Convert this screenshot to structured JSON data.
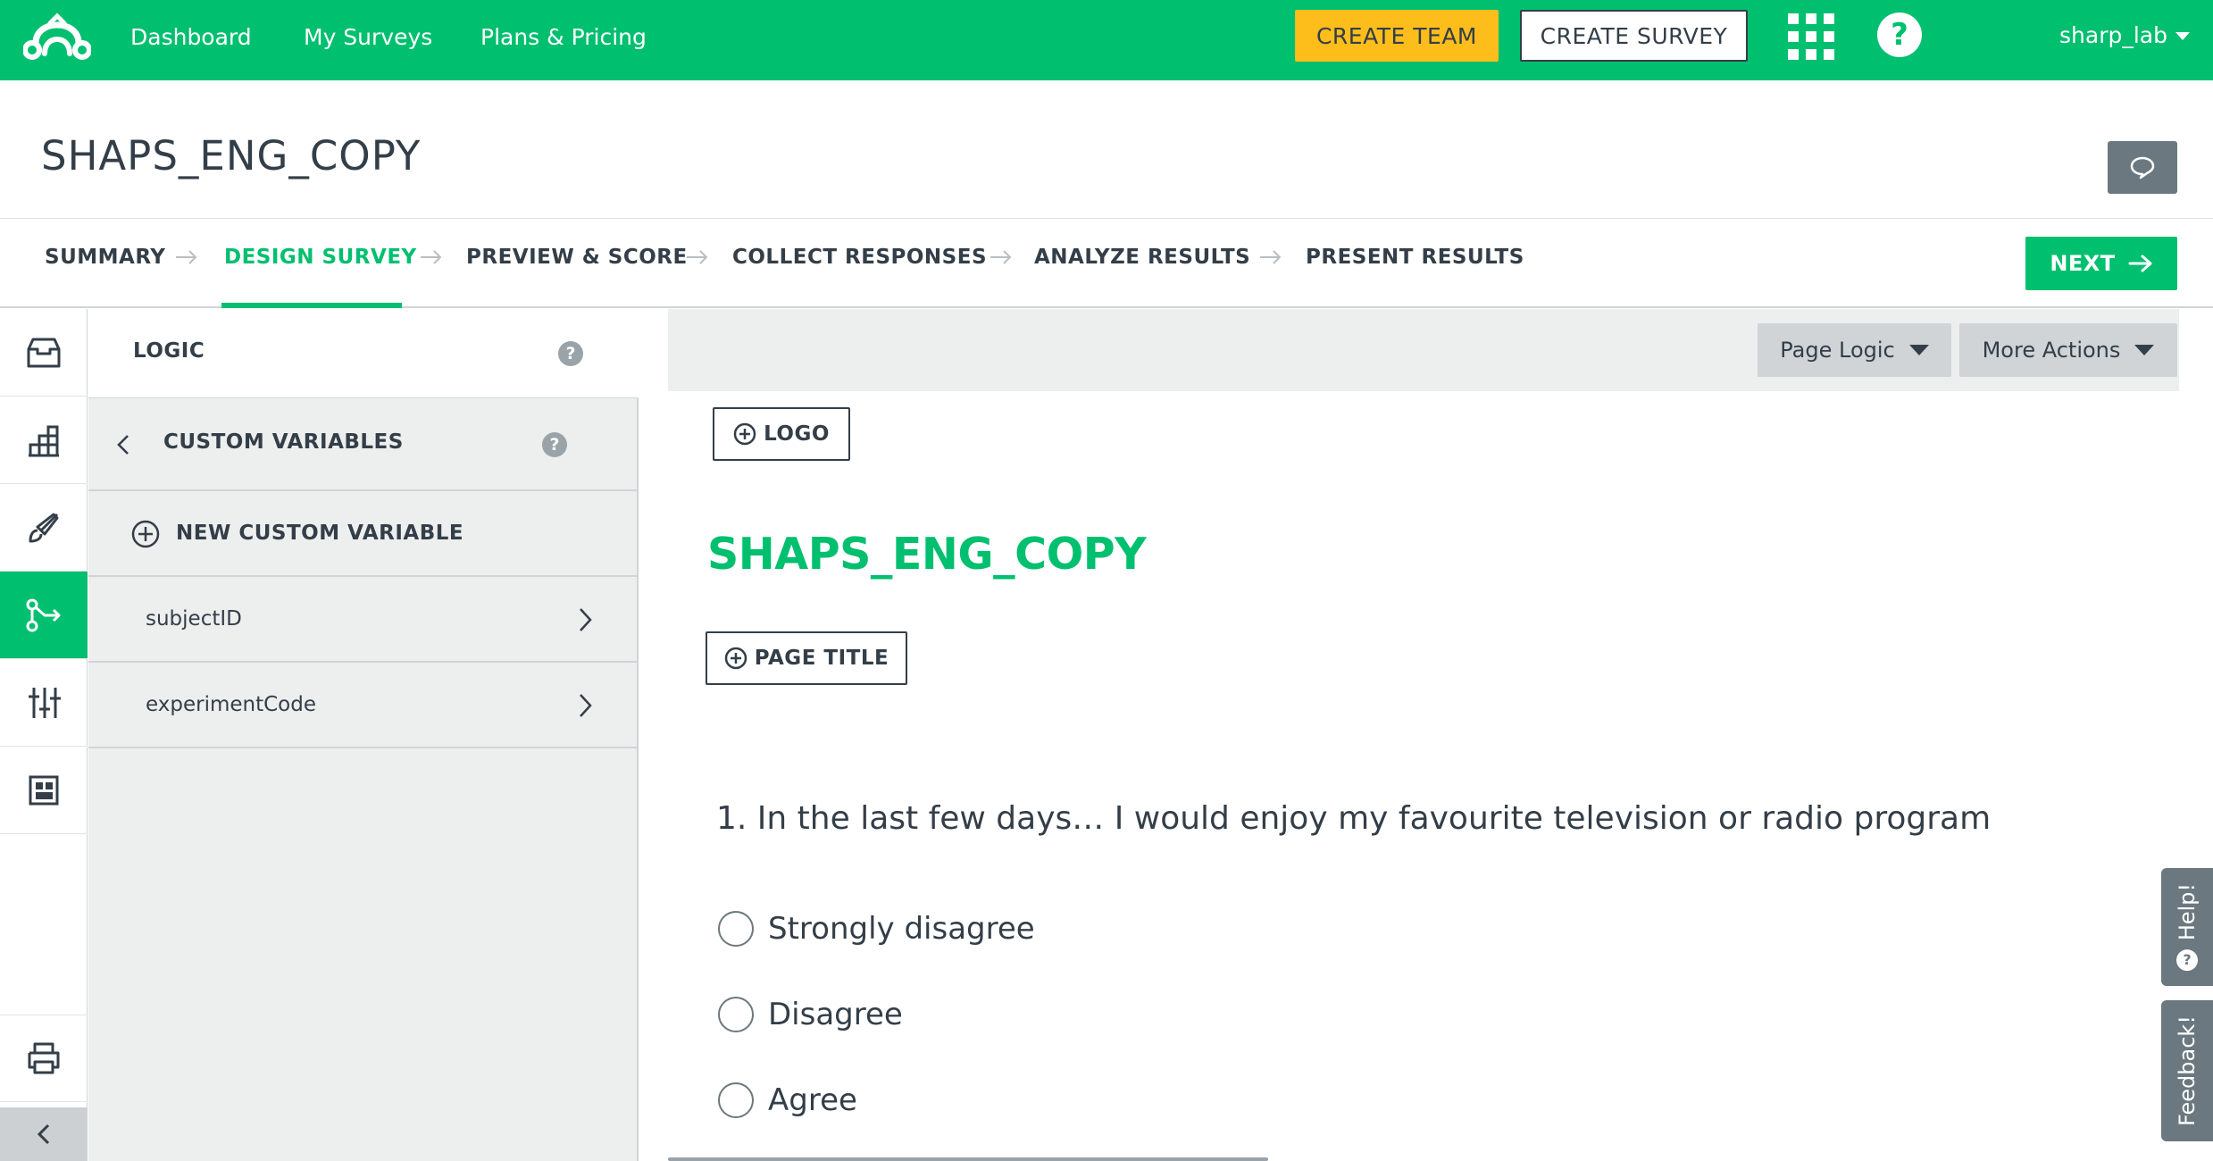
{
  "topbar": {
    "nav": [
      "Dashboard",
      "My Surveys",
      "Plans & Pricing"
    ],
    "create_team": "CREATE TEAM",
    "create_survey": "CREATE SURVEY",
    "user": "sharp_lab",
    "help_glyph": "?",
    "brand_color": "#00bf6f",
    "team_button_color": "#fdbd1b"
  },
  "header": {
    "survey_title": "SHAPS_ENG_COPY"
  },
  "steps": {
    "items": [
      "SUMMARY",
      "DESIGN SURVEY",
      "PREVIEW & SCORE",
      "COLLECT RESPONSES",
      "ANALYZE RESULTS",
      "PRESENT RESULTS"
    ],
    "active": "DESIGN SURVEY",
    "next": "NEXT"
  },
  "rail": {
    "icons": [
      "question-bank-icon",
      "builder-icon",
      "style-brush-icon",
      "logic-icon",
      "options-sliders-icon",
      "templates-icon",
      "print-icon",
      "collapse-chevron-icon"
    ],
    "active": "logic-icon"
  },
  "panel": {
    "title": "LOGIC",
    "help_glyph": "?",
    "section": "CUSTOM VARIABLES",
    "new_variable": "NEW CUSTOM VARIABLE",
    "variables": [
      "subjectID",
      "experimentCode"
    ]
  },
  "toolbar": {
    "page_logic": "Page Logic",
    "more_actions": "More Actions"
  },
  "canvas": {
    "logo_button": "LOGO",
    "title": "SHAPS_ENG_COPY",
    "page_title_button": "PAGE TITLE",
    "question": "1. In the last few days… I would enjoy my favourite television or radio program",
    "choices": [
      "Strongly disagree",
      "Disagree",
      "Agree"
    ]
  },
  "side_tabs": {
    "help": "Help!",
    "feedback": "Feedback!"
  }
}
